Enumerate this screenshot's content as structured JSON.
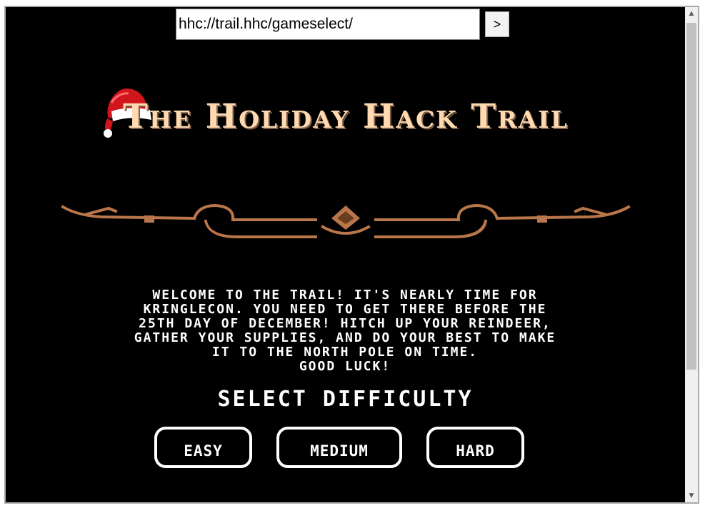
{
  "address_bar": {
    "url": "hhc://trail.hhc/gameselect/",
    "go_label": ">"
  },
  "game": {
    "title": "The Holiday Hack Trail",
    "welcome": "Welcome to the trail! It's nearly time for\nKringleCon. You need to get there before the\n25th day of December! Hitch up your reindeer,\ngather your supplies, and do your best to make\nit to the North Pole on time.\nGood luck!",
    "select_heading": "Select Difficulty",
    "difficulties": [
      "EASY",
      "MEDIUM",
      "HARD"
    ]
  },
  "icons": {
    "hat": "santa-hat-icon",
    "ornament": "scroll-ornament-divider"
  },
  "colors": {
    "background": "#000000",
    "title": "#ffd9b0",
    "ornament": "#b8764a",
    "hat_red": "#d0161c"
  },
  "scrollbar": {
    "up": "▲",
    "down": "▼"
  }
}
